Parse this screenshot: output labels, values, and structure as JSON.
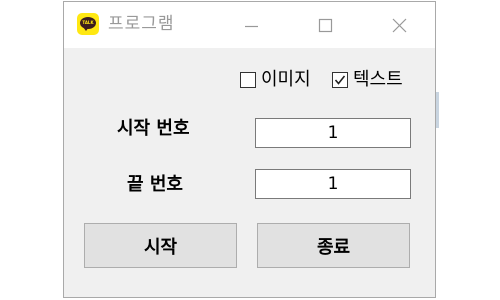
{
  "window": {
    "title": "프로그램",
    "icon": "kakaotalk-icon",
    "icon_text": "TALK",
    "controls": {
      "minimize": "minimize-icon",
      "maximize": "maximize-icon",
      "close": "close-icon"
    }
  },
  "options": {
    "image": {
      "label": "이미지",
      "checked": false
    },
    "text": {
      "label": "텍스트",
      "checked": true
    }
  },
  "fields": {
    "start": {
      "label": "시작 번호",
      "value": "1"
    },
    "end": {
      "label": "끝 번호",
      "value": "1"
    }
  },
  "buttons": {
    "start": "시작",
    "quit": "종료"
  },
  "colors": {
    "window_bg": "#f0f0f0",
    "titlebar_bg": "#ffffff",
    "title_text": "#999999",
    "button_bg": "#e1e1e1",
    "icon_yellow": "#ffe812",
    "icon_brown": "#3b1e1e"
  }
}
